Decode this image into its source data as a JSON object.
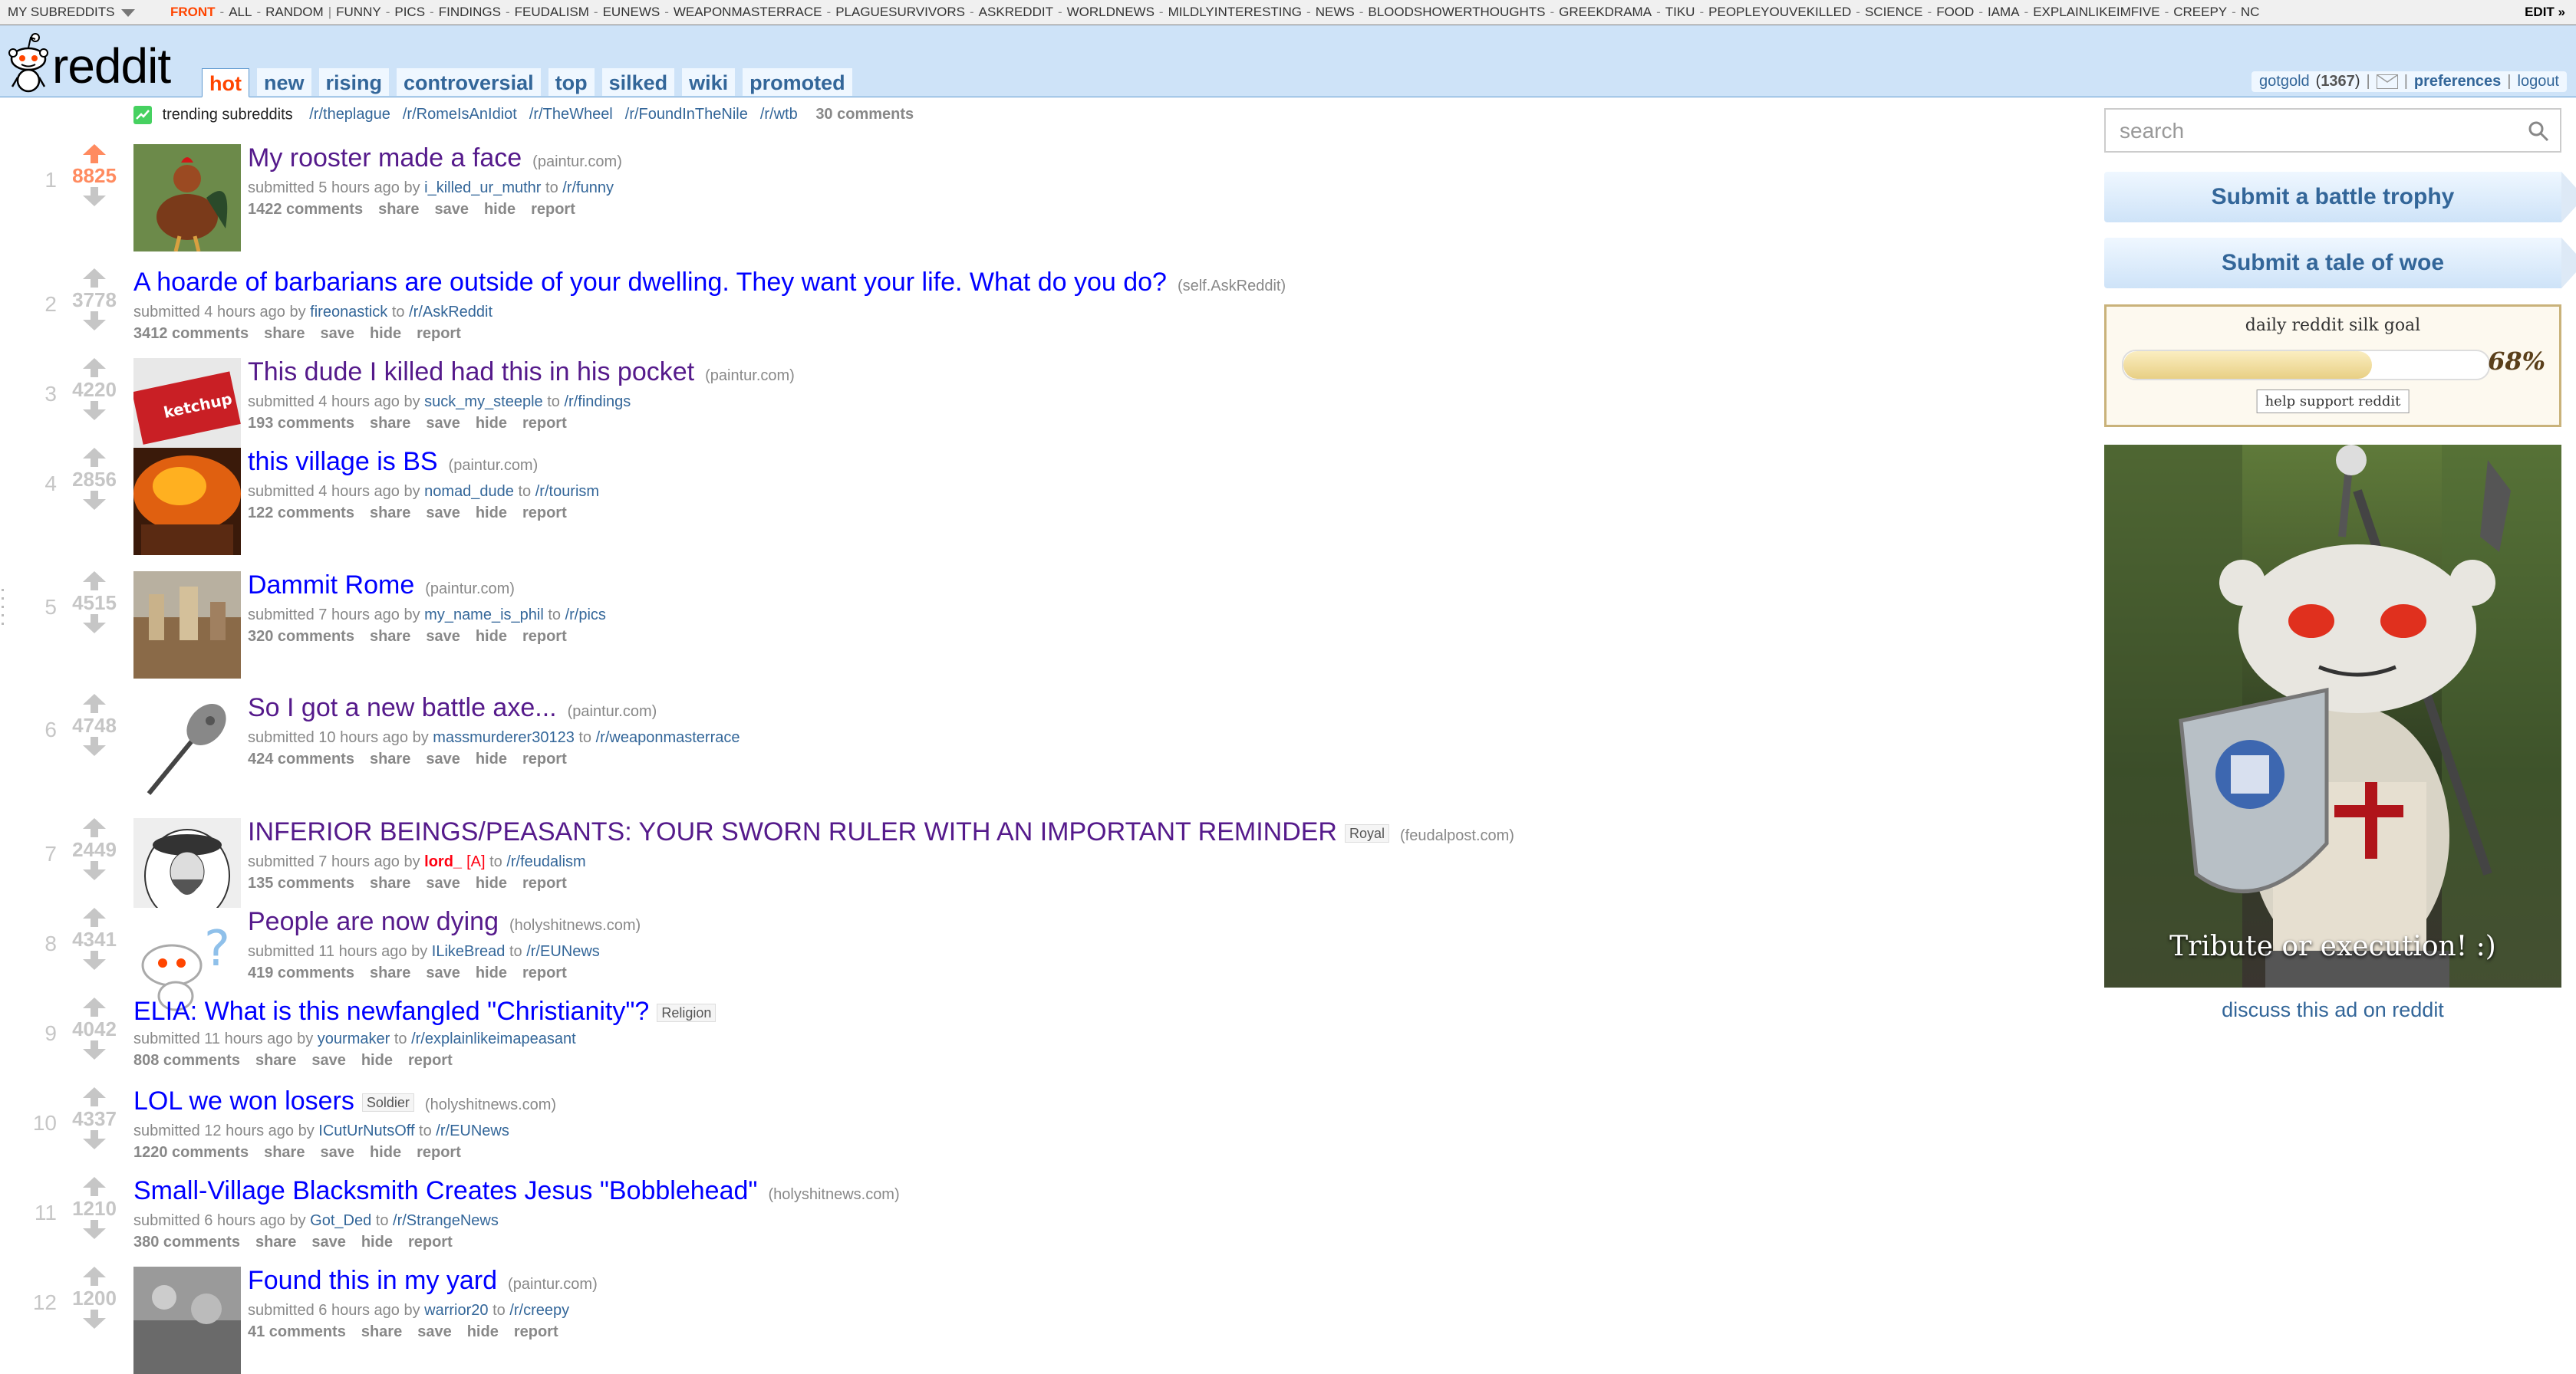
{
  "top_bar": {
    "my_subreddits": "MY SUBREDDITS",
    "subreddits": [
      "FRONT",
      "ALL",
      "RANDOM",
      "FUNNY",
      "PICS",
      "FINDINGS",
      "FEUDALISM",
      "EUNEWS",
      "WEAPONMASTERRACE",
      "PLAGUESURVIVORS",
      "ASKREDDIT",
      "WORLDNEWS",
      "MILDLYINTERESTING",
      "NEWS",
      "BLOODSHOWERTHOUGHTS",
      "GREEKDRAMA",
      "TIKU",
      "PEOPLEYOUVEKILLED",
      "SCIENCE",
      "FOOD",
      "IAMA",
      "EXPLAINLIKEIMFIVE",
      "CREEPY",
      "NC"
    ],
    "selected": "FRONT",
    "edit_label": "EDIT »"
  },
  "header": {
    "logo_text": "reddit",
    "tabs": [
      {
        "label": "hot",
        "selected": true
      },
      {
        "label": "new",
        "selected": false
      },
      {
        "label": "rising",
        "selected": false
      },
      {
        "label": "controversial",
        "selected": false
      },
      {
        "label": "top",
        "selected": false
      },
      {
        "label": "silked",
        "selected": false
      },
      {
        "label": "wiki",
        "selected": false
      },
      {
        "label": "promoted",
        "selected": false
      }
    ],
    "user": {
      "username": "gotgold",
      "karma": "1367",
      "preferences": "preferences",
      "logout": "logout"
    }
  },
  "trending": {
    "label": "trending subreddits",
    "links": [
      "/r/theplague",
      "/r/RomeIsAnIdiot",
      "/r/TheWheel",
      "/r/FoundInTheNile",
      "/r/wtb"
    ],
    "comments": "30 comments"
  },
  "posts": [
    {
      "rank": "1",
      "score": "8825",
      "liked": true,
      "title": "My rooster made a face",
      "visited": true,
      "domain": "(paintur.com)",
      "flair": "",
      "age": "5 hours ago",
      "author": "i_killed_ur_muthr",
      "author_admin": false,
      "subreddit": "/r/funny",
      "comments": "1422 comments",
      "thumb": "rooster"
    },
    {
      "rank": "2",
      "score": "3778",
      "liked": false,
      "title": "A hoarde of barbarians are outside of your dwelling. They want your life. What do you do?",
      "visited": false,
      "domain": "(self.AskReddit)",
      "flair": "",
      "age": "4 hours ago",
      "author": "fireonastick",
      "author_admin": false,
      "subreddit": "/r/AskReddit",
      "comments": "3412 comments",
      "thumb": ""
    },
    {
      "rank": "3",
      "score": "4220",
      "liked": false,
      "title": "This dude I killed had this in his pocket",
      "visited": true,
      "domain": "(paintur.com)",
      "flair": "",
      "age": "4 hours ago",
      "author": "suck_my_steeple",
      "author_admin": false,
      "subreddit": "/r/findings",
      "comments": "193 comments",
      "thumb": "ketchup"
    },
    {
      "rank": "4",
      "score": "2856",
      "liked": false,
      "title": "this village is BS",
      "visited": false,
      "domain": "(paintur.com)",
      "flair": "",
      "age": "4 hours ago",
      "author": "nomad_dude",
      "author_admin": false,
      "subreddit": "/r/tourism",
      "comments": "122 comments",
      "thumb": "fire"
    },
    {
      "rank": "5",
      "score": "4515",
      "liked": false,
      "title": "Dammit Rome",
      "visited": false,
      "domain": "(paintur.com)",
      "flair": "",
      "age": "7 hours ago",
      "author": "my_name_is_phil",
      "author_admin": false,
      "subreddit": "/r/pics",
      "comments": "320 comments",
      "thumb": "rome"
    },
    {
      "rank": "6",
      "score": "4748",
      "liked": false,
      "title": "So I got a new battle axe...",
      "visited": true,
      "domain": "(paintur.com)",
      "flair": "",
      "age": "10 hours ago",
      "author": "massmurderer30123",
      "author_admin": false,
      "subreddit": "/r/weaponmasterrace",
      "comments": "424 comments",
      "thumb": "axe"
    },
    {
      "rank": "7",
      "score": "2449",
      "liked": false,
      "title": "INFERIOR BEINGS/PEASANTS: YOUR SWORN RULER WITH AN IMPORTANT REMINDER",
      "visited": true,
      "domain": "(feudalpost.com)",
      "flair": "Royal",
      "age": "7 hours ago",
      "author": "lord_",
      "author_admin": true,
      "admin_tag": "[A]",
      "subreddit": "/r/feudalism",
      "comments": "135 comments",
      "thumb": "portrait"
    },
    {
      "rank": "8",
      "score": "4341",
      "liked": false,
      "title": "People are now dying",
      "visited": true,
      "domain": "(holyshitnews.com)",
      "flair": "",
      "age": "11 hours ago",
      "author": "ILikeBread",
      "author_admin": false,
      "subreddit": "/r/EUNews",
      "comments": "419 comments",
      "thumb": "snoo"
    },
    {
      "rank": "9",
      "score": "4042",
      "liked": false,
      "title": "ELIA: What is this newfangled \"Christianity\"?",
      "visited": false,
      "domain": "",
      "flair": "Religion",
      "age": "11 hours ago",
      "author": "yourmaker",
      "author_admin": false,
      "subreddit": "/r/explainlikeimapeasant",
      "comments": "808 comments",
      "thumb": ""
    },
    {
      "rank": "10",
      "score": "4337",
      "liked": false,
      "title": "LOL we won losers",
      "visited": false,
      "domain": "(holyshitnews.com)",
      "flair": "Soldier",
      "age": "12 hours ago",
      "author": "ICutUrNutsOff",
      "author_admin": false,
      "subreddit": "/r/EUNews",
      "comments": "1220 comments",
      "thumb": ""
    },
    {
      "rank": "11",
      "score": "1210",
      "liked": false,
      "title": "Small-Village Blacksmith Creates Jesus \"Bobblehead\"",
      "visited": false,
      "domain": "(holyshitnews.com)",
      "flair": "",
      "age": "6 hours ago",
      "author": "Got_Ded",
      "author_admin": false,
      "subreddit": "/r/StrangeNews",
      "comments": "380 comments",
      "thumb": ""
    },
    {
      "rank": "12",
      "score": "1200",
      "liked": false,
      "title": "Found this in my yard",
      "visited": false,
      "domain": "(paintur.com)",
      "flair": "",
      "age": "6 hours ago",
      "author": "warrior20",
      "author_admin": false,
      "subreddit": "/r/creepy",
      "comments": "41 comments",
      "thumb": "yard"
    }
  ],
  "post_buttons": {
    "share": "share",
    "save": "save",
    "hide": "hide",
    "report": "report"
  },
  "tagline_words": {
    "submitted": "submitted",
    "by": "by",
    "to": "to"
  },
  "sidebar": {
    "search_placeholder": "search",
    "submit_link": "Submit a battle trophy",
    "submit_text": "Submit a tale of woe",
    "goal": {
      "title": "daily reddit silk goal",
      "percent": 68,
      "percent_label": "68%",
      "help": "help support reddit"
    },
    "ad_caption": "Tribute or execution! :)",
    "discuss_ad": "discuss this ad on reddit"
  },
  "colors": {
    "header_bg": "#cee3f8",
    "link": "#0000ff",
    "visited": "#551a8b",
    "upvote": "#ff8b60",
    "accent": "#ff4500"
  }
}
